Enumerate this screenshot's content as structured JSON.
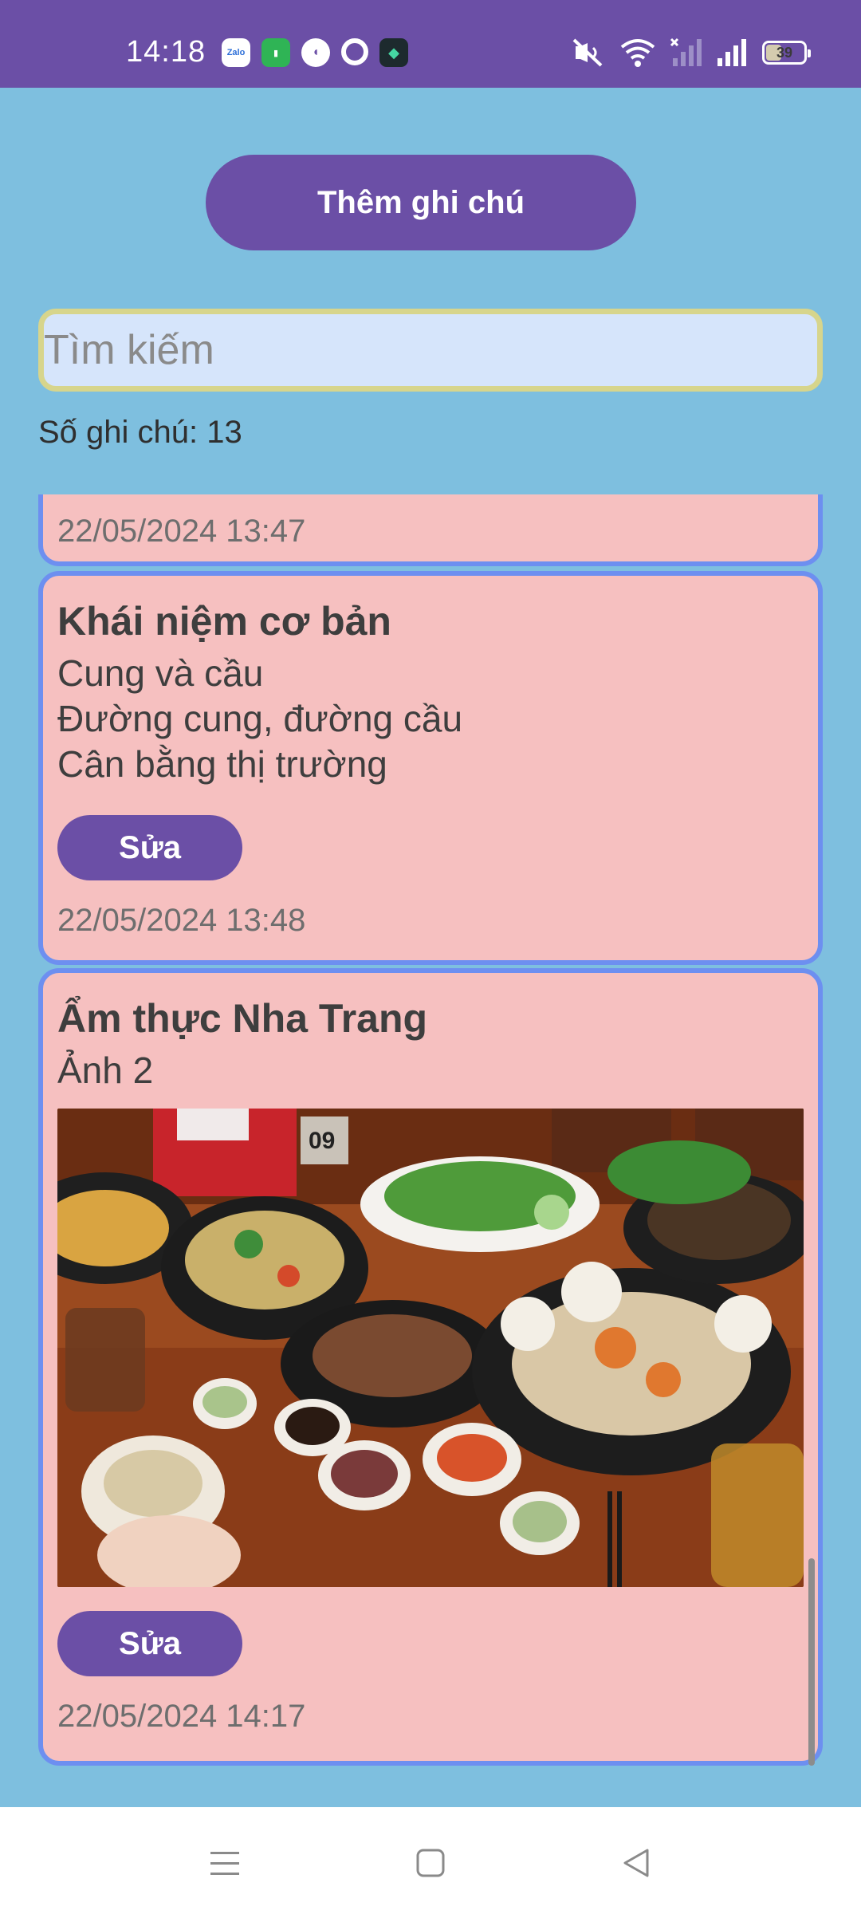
{
  "status_bar": {
    "time": "14:18",
    "notification_icons": [
      "zalo-icon",
      "green-app-icon",
      "app-circle-icon",
      "ring-app-icon",
      "dark-app-icon"
    ],
    "zalo_label": "Zalo",
    "battery_level": "39",
    "system_icons": [
      "mute-icon",
      "wifi-icon",
      "signal-icon-1",
      "signal-icon-2",
      "battery-icon"
    ]
  },
  "header": {
    "add_button_label": "Thêm ghi chú"
  },
  "search": {
    "placeholder": "Tìm kiếm"
  },
  "note_count_text": "Số ghi chú: 13",
  "notes": [
    {
      "title": "",
      "body": "",
      "date": "22/05/2024 13:47"
    },
    {
      "title": "Khái niệm cơ bản",
      "body": "Cung và cầu\nĐường cung, đường cầu\nCân bằng thị trường",
      "edit_label": "Sửa",
      "date": "22/05/2024 13:48"
    },
    {
      "title": "Ẩm thực Nha Trang",
      "body": "Ảnh 2",
      "image": "food-table-photo",
      "photo_table_number": "09",
      "edit_label": "Sửa",
      "date": "22/05/2024 14:17"
    }
  ],
  "navbar": {
    "items": [
      "menu-icon",
      "home-square-icon",
      "back-triangle-icon"
    ]
  },
  "colors": {
    "background": "#7ebfdf",
    "primary": "#6b4fa6",
    "card": "#f6c0c0",
    "card_border": "#6d8ff0",
    "search_bg": "#d6e5fb",
    "search_border": "#d7d58c"
  }
}
